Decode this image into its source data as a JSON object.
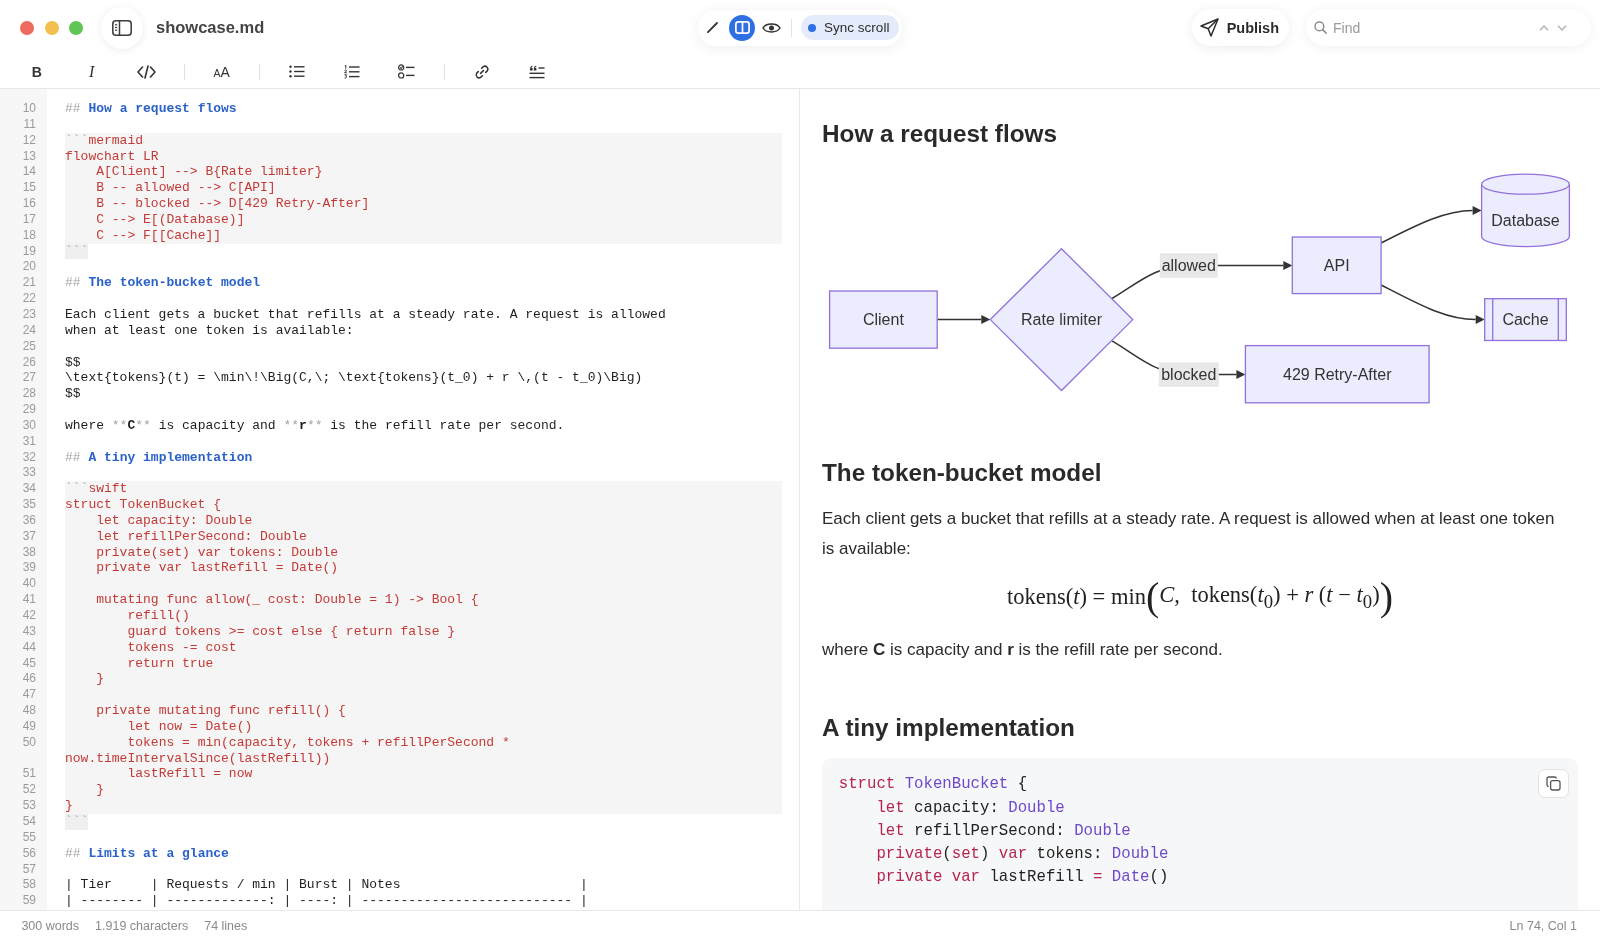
{
  "window": {
    "title": "showcase.md"
  },
  "view_modes": [
    {
      "kind": "edit",
      "selected": false
    },
    {
      "kind": "split",
      "selected": true
    },
    {
      "kind": "preview",
      "selected": false
    }
  ],
  "sync_scroll": {
    "label": "Sync scroll",
    "on": true
  },
  "publish": {
    "label": "Publish"
  },
  "find": {
    "placeholder": "Find"
  },
  "format_toolbar": {
    "groups": [
      {
        "tools": [
          {
            "kind": "bold",
            "label": "B"
          },
          {
            "kind": "italic",
            "label": "I"
          },
          {
            "kind": "code"
          }
        ]
      },
      {
        "tools": [
          {
            "kind": "text-size",
            "label": "AA"
          }
        ]
      },
      {
        "tools": [
          {
            "kind": "bullet-list"
          },
          {
            "kind": "numbered-list"
          },
          {
            "kind": "task-list"
          }
        ]
      },
      {
        "tools": [
          {
            "kind": "link"
          },
          {
            "kind": "quote"
          }
        ]
      }
    ]
  },
  "editor": {
    "lines": [
      {
        "number": "10",
        "kind": "heading",
        "marker": "##",
        "text": "How a request flows"
      },
      {
        "number": "11",
        "kind": "blank"
      },
      {
        "number": "12",
        "kind": "fence-open",
        "marker": "```",
        "text": "mermaid"
      },
      {
        "number": "13",
        "kind": "code",
        "text": "flowchart LR"
      },
      {
        "number": "14",
        "kind": "code",
        "text": "    A[Client] --> B{Rate limiter}"
      },
      {
        "number": "15",
        "kind": "code",
        "text": "    B -- allowed --> C[API]"
      },
      {
        "number": "16",
        "kind": "code",
        "text": "    B -- blocked --> D[429 Retry-After]"
      },
      {
        "number": "17",
        "kind": "code",
        "text": "    C --> E[(Database)]"
      },
      {
        "number": "18",
        "kind": "code",
        "text": "    C --> F[[Cache]]"
      },
      {
        "number": "19",
        "kind": "fence-close",
        "marker": "```"
      },
      {
        "number": "20",
        "kind": "blank"
      },
      {
        "number": "21",
        "kind": "heading",
        "marker": "##",
        "text": "The token-bucket model"
      },
      {
        "number": "22",
        "kind": "blank"
      },
      {
        "number": "23",
        "kind": "text",
        "text": "Each client gets a bucket that refills at a steady rate. A request is allowed"
      },
      {
        "number": "24",
        "kind": "text",
        "text": "when at least one token is available:"
      },
      {
        "number": "25",
        "kind": "blank"
      },
      {
        "number": "26",
        "kind": "text",
        "text": "$$"
      },
      {
        "number": "27",
        "kind": "text",
        "text": "\\text{tokens}(t) = \\min\\!\\Big(C,\\; \\text{tokens}(t_0) + r \\,(t - t_0)\\Big)"
      },
      {
        "number": "28",
        "kind": "text",
        "text": "$$"
      },
      {
        "number": "29",
        "kind": "blank"
      },
      {
        "number": "30",
        "kind": "inline",
        "parts": [
          {
            "kind": "plain",
            "text": "where "
          },
          {
            "kind": "mark",
            "text": "**"
          },
          {
            "kind": "strong",
            "text": "C"
          },
          {
            "kind": "mark",
            "text": "**"
          },
          {
            "kind": "plain",
            "text": " is capacity and "
          },
          {
            "kind": "mark",
            "text": "**"
          },
          {
            "kind": "strong",
            "text": "r"
          },
          {
            "kind": "mark",
            "text": "**"
          },
          {
            "kind": "plain",
            "text": " is the refill rate per second."
          }
        ]
      },
      {
        "number": "31",
        "kind": "blank"
      },
      {
        "number": "32",
        "kind": "heading",
        "marker": "##",
        "text": "A tiny implementation"
      },
      {
        "number": "33",
        "kind": "blank"
      },
      {
        "number": "34",
        "kind": "fence-open",
        "marker": "```",
        "text": "swift"
      },
      {
        "number": "35",
        "kind": "code",
        "text": "struct TokenBucket {"
      },
      {
        "number": "36",
        "kind": "code",
        "text": "    let capacity: Double"
      },
      {
        "number": "37",
        "kind": "code",
        "text": "    let refillPerSecond: Double"
      },
      {
        "number": "38",
        "kind": "code",
        "text": "    private(set) var tokens: Double"
      },
      {
        "number": "39",
        "kind": "code",
        "text": "    private var lastRefill = Date()"
      },
      {
        "number": "40",
        "kind": "code"
      },
      {
        "number": "41",
        "kind": "code",
        "text": "    mutating func allow(_ cost: Double = 1) -> Bool {"
      },
      {
        "number": "42",
        "kind": "code",
        "text": "        refill()"
      },
      {
        "number": "43",
        "kind": "code",
        "text": "        guard tokens >= cost else { return false }"
      },
      {
        "number": "44",
        "kind": "code",
        "text": "        tokens -= cost"
      },
      {
        "number": "45",
        "kind": "code",
        "text": "        return true"
      },
      {
        "number": "46",
        "kind": "code",
        "text": "    }"
      },
      {
        "number": "47",
        "kind": "code"
      },
      {
        "number": "48",
        "kind": "code",
        "text": "    private mutating func refill() {"
      },
      {
        "number": "49",
        "kind": "code",
        "text": "        let now = Date()"
      },
      {
        "number": "50",
        "kind": "code",
        "text": "        tokens = min(capacity, tokens + refillPerSecond * now.timeIntervalSince(lastRefill))"
      },
      {
        "number": "51",
        "kind": "code",
        "text": "        lastRefill = now"
      },
      {
        "number": "52",
        "kind": "code",
        "text": "    }"
      },
      {
        "number": "53",
        "kind": "code",
        "text": "}"
      },
      {
        "number": "54",
        "kind": "fence-close",
        "marker": "```"
      },
      {
        "number": "55",
        "kind": "blank"
      },
      {
        "number": "56",
        "kind": "heading",
        "marker": "##",
        "text": "Limits at a glance"
      },
      {
        "number": "57",
        "kind": "blank"
      },
      {
        "number": "58",
        "kind": "text",
        "text": "| Tier     | Requests / min | Burst | Notes                       |"
      },
      {
        "number": "59",
        "kind": "text",
        "text": "| -------- | -------------: | ----: | --------------------------- |"
      }
    ]
  },
  "preview": {
    "blocks": [
      {
        "kind": "heading",
        "text": "How a request flows"
      },
      {
        "kind": "flowchart",
        "nodes": [
          {
            "label": "Client",
            "kind": "rect"
          },
          {
            "label": "Rate limiter",
            "kind": "diamond"
          },
          {
            "label": "API",
            "kind": "rect"
          },
          {
            "label": "429 Retry-After",
            "kind": "rect"
          },
          {
            "label": "Database",
            "kind": "cylinder"
          },
          {
            "label": "Cache",
            "kind": "subroutine"
          }
        ],
        "edges": [
          {
            "kind": "arrow"
          },
          {
            "kind": "arrow",
            "label": "allowed"
          },
          {
            "kind": "arrow",
            "label": "blocked"
          },
          {
            "kind": "arrow"
          },
          {
            "kind": "arrow"
          }
        ]
      },
      {
        "kind": "heading",
        "text": "The token-bucket model"
      },
      {
        "kind": "paragraph",
        "text": "Each client gets a bucket that refills at a steady rate. A request is allowed when at least one token is available:"
      },
      {
        "kind": "math",
        "lhs": "tokens(*t*) = min",
        "open": "(",
        "body": "*C*,  tokens(*t*$_{0}$) + *r* (*t* − *t*$_{0}$)",
        "close": ")"
      },
      {
        "kind": "paragraph",
        "text": "where **C** is capacity and **r** is the refill rate per second."
      },
      {
        "kind": "heading",
        "text": "A tiny implementation"
      },
      {
        "kind": "code",
        "lines": [
          {
            "tokens": [
              {
                "kind": "keyword",
                "text": "struct"
              },
              {
                "kind": "type",
                "text": " TokenBucket"
              },
              {
                "kind": "plain",
                "text": " {"
              }
            ]
          },
          {
            "tokens": [
              {
                "kind": "keyword",
                "text": "    let"
              },
              {
                "kind": "plain",
                "text": " capacity: "
              },
              {
                "kind": "type",
                "text": "Double"
              }
            ]
          },
          {
            "tokens": [
              {
                "kind": "keyword",
                "text": "    let"
              },
              {
                "kind": "plain",
                "text": " refillPerSecond: "
              },
              {
                "kind": "type",
                "text": "Double"
              }
            ]
          },
          {
            "tokens": [
              {
                "kind": "keyword",
                "text": "    private"
              },
              {
                "kind": "plain",
                "text": "("
              },
              {
                "kind": "keyword",
                "text": "set"
              },
              {
                "kind": "plain",
                "text": ") "
              },
              {
                "kind": "keyword",
                "text": "var"
              },
              {
                "kind": "plain",
                "text": " tokens: "
              },
              {
                "kind": "type",
                "text": "Double"
              }
            ]
          },
          {
            "tokens": [
              {
                "kind": "keyword",
                "text": "    private"
              },
              {
                "kind": "keyword",
                "text": " var"
              },
              {
                "kind": "plain",
                "text": " lastRefill "
              },
              {
                "kind": "keyword",
                "text": "="
              },
              {
                "kind": "type",
                "text": " Date"
              },
              {
                "kind": "plain",
                "text": "()"
              }
            ]
          }
        ]
      }
    ]
  },
  "status_bar": {
    "items": [
      "300 words",
      "1.919 characters",
      "74 lines"
    ],
    "position": "Ln 74, Col 1"
  }
}
